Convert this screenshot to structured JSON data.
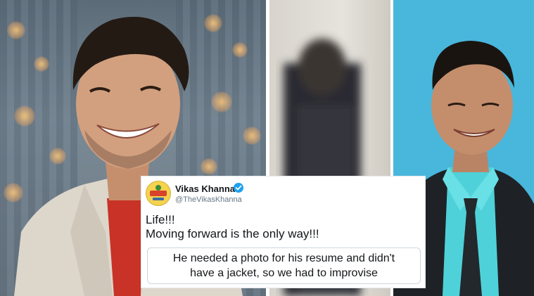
{
  "tweet": {
    "display_name": "Vikas Khanna",
    "handle": "@TheVikasKhanna",
    "verified": true,
    "text_lines": [
      "Life!!!",
      "Moving forward is the only way!!!"
    ],
    "quote_lines": [
      "He needed a photo for his resume and didn't",
      "have a jacket, so we had to improvise"
    ],
    "avatar_icon": "avatar-logo-icon",
    "verified_icon": "verified-badge-icon"
  },
  "photos": [
    {
      "name": "smiling-chef-photo"
    },
    {
      "name": "blurred-person-photo"
    },
    {
      "name": "young-man-resume-photo"
    }
  ],
  "colors": {
    "verified_blue": "#1da1f2",
    "right_background": "#49b6dc",
    "shirt_turquoise": "#4fd1d9",
    "jacket_dark": "#1e2226",
    "left_jacket": "#ddd6cb",
    "left_shirt_red": "#c93226"
  }
}
